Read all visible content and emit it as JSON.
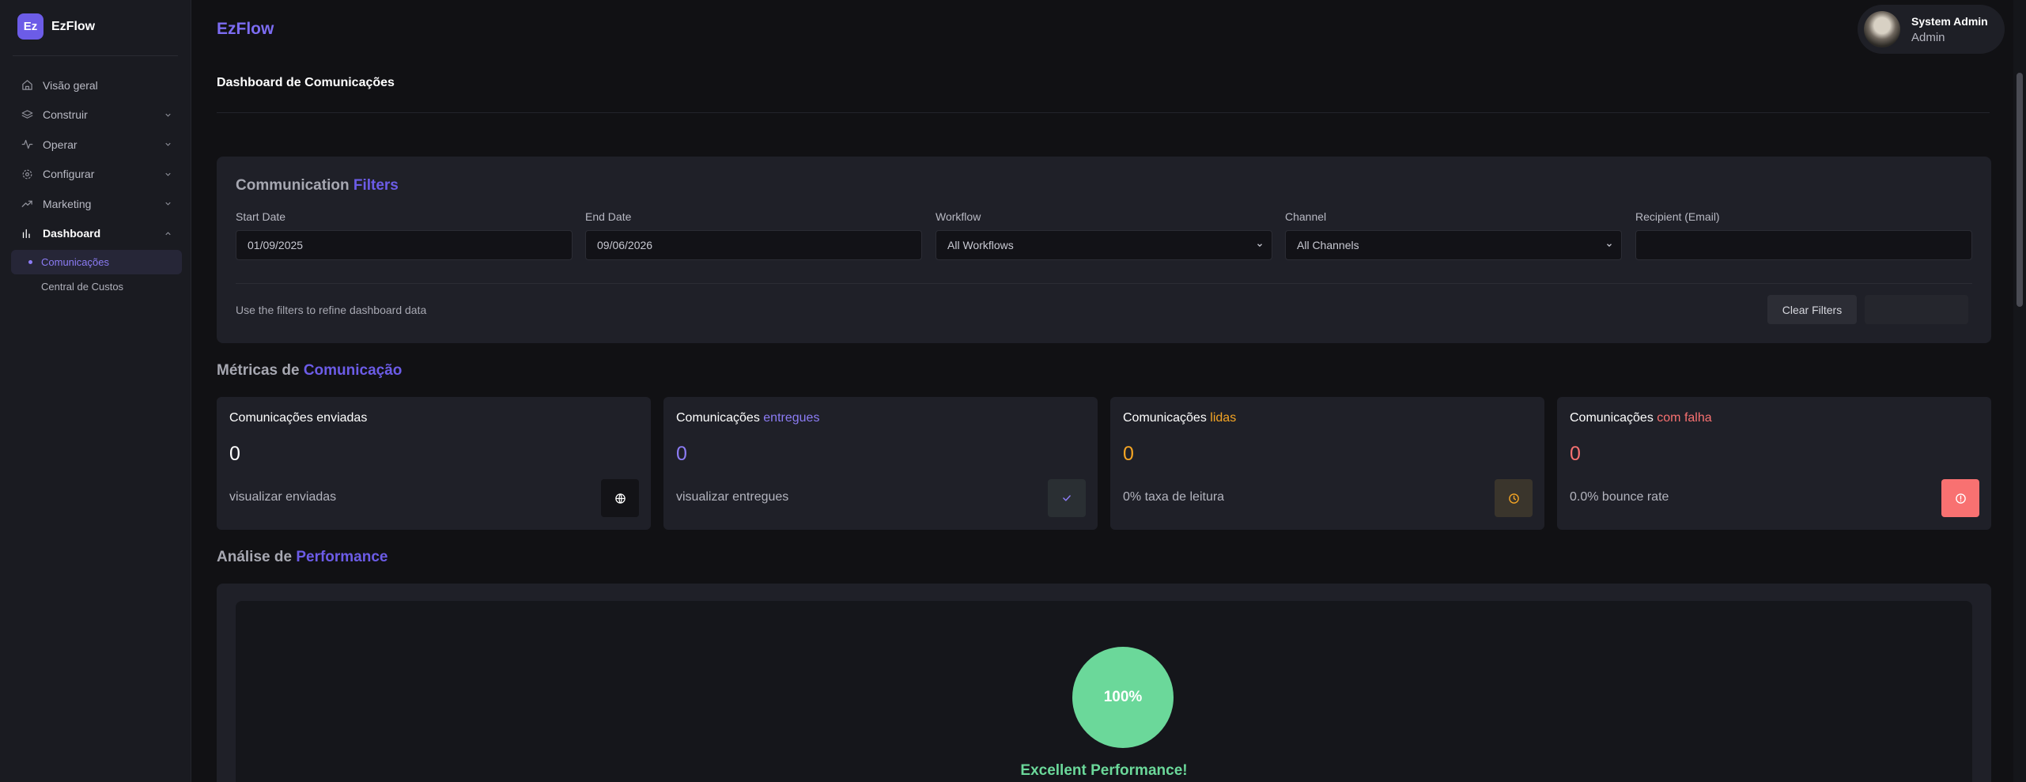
{
  "brand": {
    "logo_text": "Ez",
    "name": "EzFlow"
  },
  "sidebar": {
    "items": [
      {
        "label": "Visão geral",
        "icon": "home-icon"
      },
      {
        "label": "Construir",
        "icon": "layers-icon"
      },
      {
        "label": "Operar",
        "icon": "activity-icon"
      },
      {
        "label": "Configurar",
        "icon": "gear-icon"
      },
      {
        "label": "Marketing",
        "icon": "trending-up-icon"
      },
      {
        "label": "Dashboard",
        "icon": "bar-chart-icon"
      }
    ],
    "sub_items": [
      {
        "label": "Comunicações"
      },
      {
        "label": "Central de Custos"
      }
    ]
  },
  "header": {
    "title": "EzFlow"
  },
  "user": {
    "name": "System Admin",
    "role": "Admin"
  },
  "page": {
    "title": "Dashboard de Comunicações"
  },
  "filters": {
    "title_prefix": "Communication",
    "title_accent": "Filters",
    "start_date": {
      "label": "Start Date",
      "value": "01/09/2025"
    },
    "end_date": {
      "label": "End Date",
      "value": "09/06/2026"
    },
    "workflow": {
      "label": "Workflow",
      "value": "All Workflows"
    },
    "channel": {
      "label": "Channel",
      "value": "All Channels"
    },
    "recipient": {
      "label": "Recipient (Email)",
      "value": ""
    },
    "hint": "Use the filters to refine dashboard data",
    "clear_label": "Clear Filters"
  },
  "metrics": {
    "title_prefix": "Métricas de",
    "title_accent": "Comunicação",
    "cards": [
      {
        "title_prefix": "Comunicações enviadas",
        "title_accent": "",
        "value": "0",
        "sub": "visualizar enviadas",
        "icon": "globe-icon",
        "accent_color": "#ffffff",
        "icon_bg": "#131317"
      },
      {
        "title_prefix": "Comunicações",
        "title_accent": "entregues",
        "value": "0",
        "sub": "visualizar entregues",
        "icon": "check-icon",
        "accent_color": "#8c7cf5",
        "icon_bg": "#2a2f33"
      },
      {
        "title_prefix": "Comunicações",
        "title_accent": "lidas",
        "value": "0",
        "sub": "0% taxa de leitura",
        "icon": "clock-icon",
        "accent_color": "#f5a524",
        "icon_bg": "#3a352c"
      },
      {
        "title_prefix": "Comunicações",
        "title_accent": "com falha",
        "value": "0",
        "sub": "0.0% bounce rate",
        "icon": "alert-circle-icon",
        "accent_color": "#f87171",
        "icon_bg": "#f87171"
      }
    ]
  },
  "performance": {
    "title_prefix": "Análise de",
    "title_accent": "Performance",
    "score": "100%",
    "status": "Excellent Performance!"
  }
}
